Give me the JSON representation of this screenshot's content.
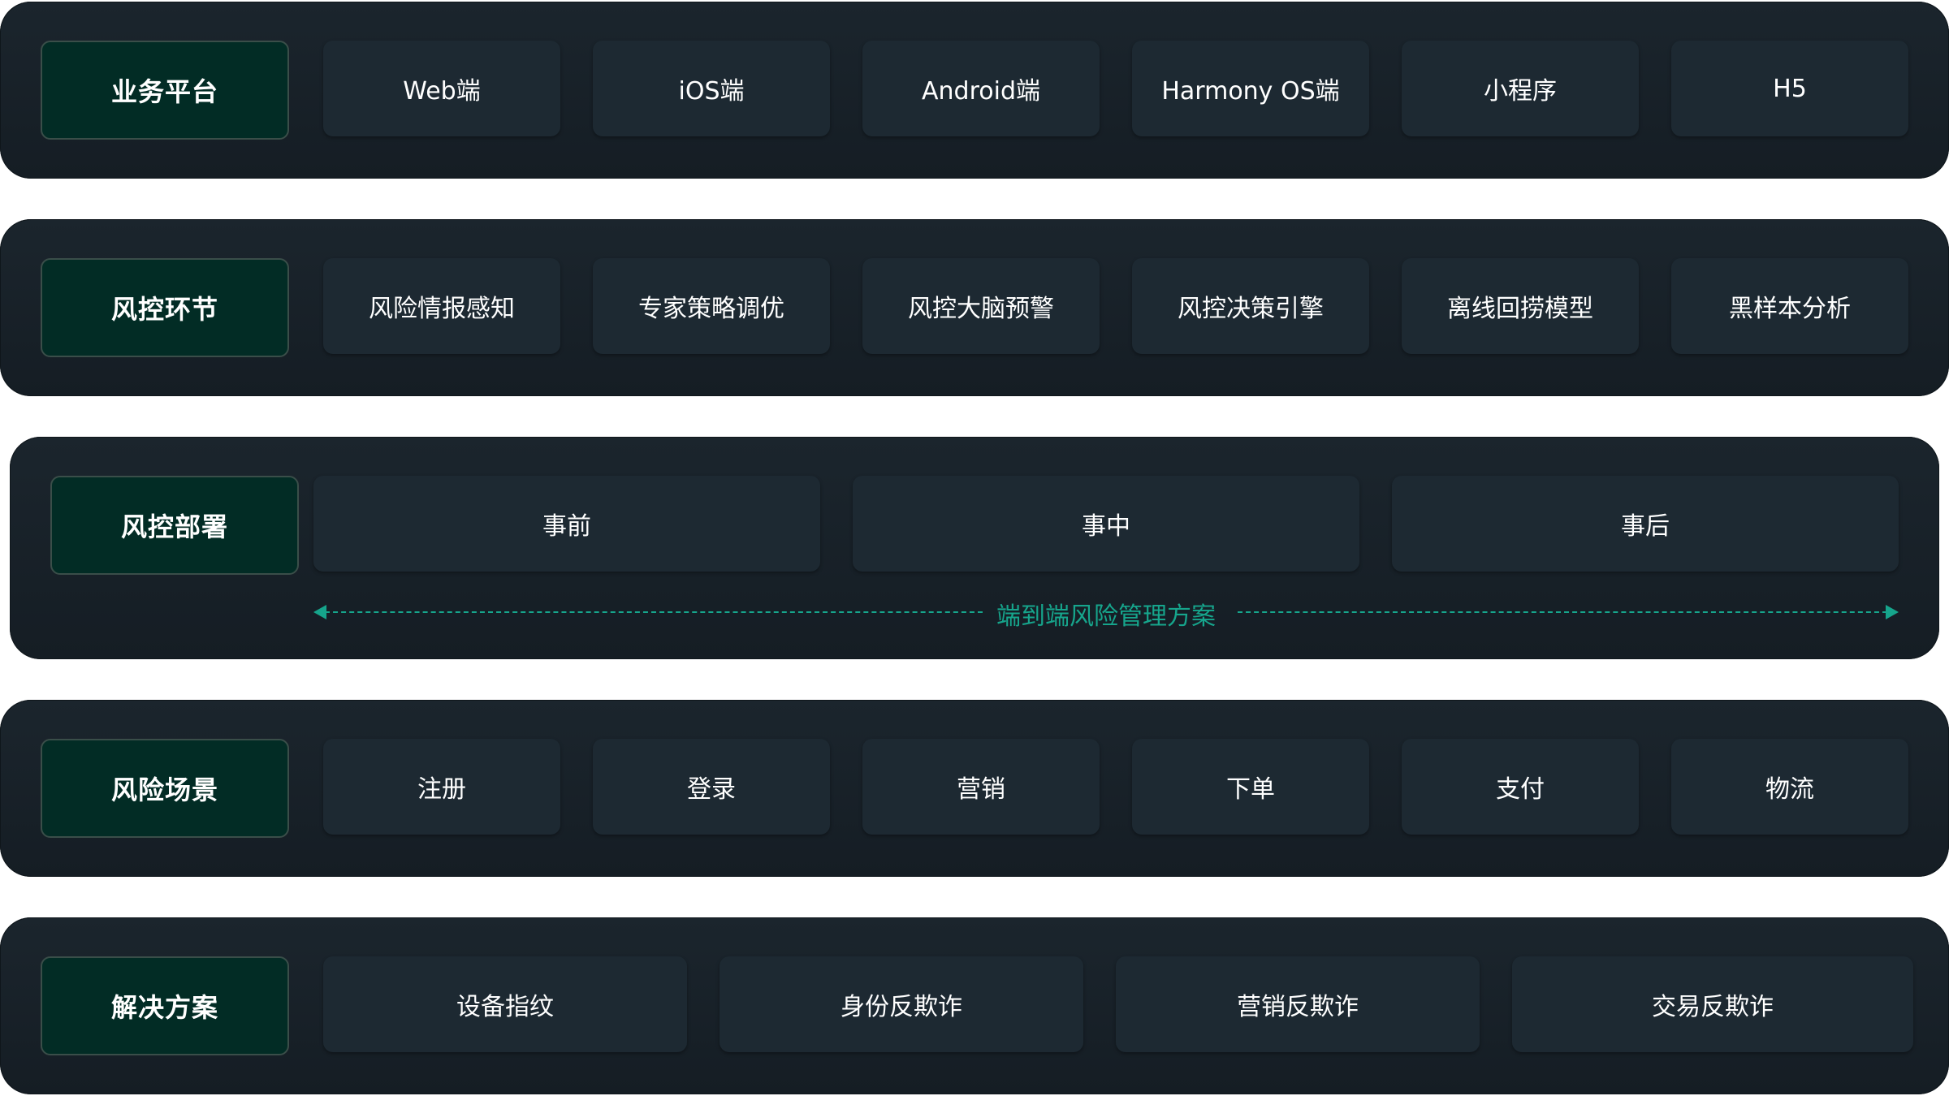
{
  "rows": [
    {
      "label": "业务平台",
      "items": [
        "Web端",
        "iOS端",
        "Android端",
        "Harmony OS端",
        "小程序",
        "H5"
      ]
    },
    {
      "label": "风控环节",
      "items": [
        "风险情报感知",
        "专家策略调优",
        "风控大脑预警",
        "风控决策引擎",
        "离线回捞模型",
        "黑样本分析"
      ]
    },
    {
      "label": "风控部署",
      "items": [
        "事前",
        "事中",
        "事后"
      ],
      "arrow_text": "端到端风险管理方案"
    },
    {
      "label": "风险场景",
      "items": [
        "注册",
        "登录",
        "营销",
        "下单",
        "支付",
        "物流"
      ]
    },
    {
      "label": "解决方案",
      "items": [
        "设备指纹",
        "身份反欺诈",
        "营销反欺诈",
        "交易反欺诈"
      ]
    }
  ],
  "colors": {
    "row_bg": "#18222a",
    "label_bg": "#022c25",
    "cell_bg": "#1d2932",
    "accent": "#16a58c"
  }
}
